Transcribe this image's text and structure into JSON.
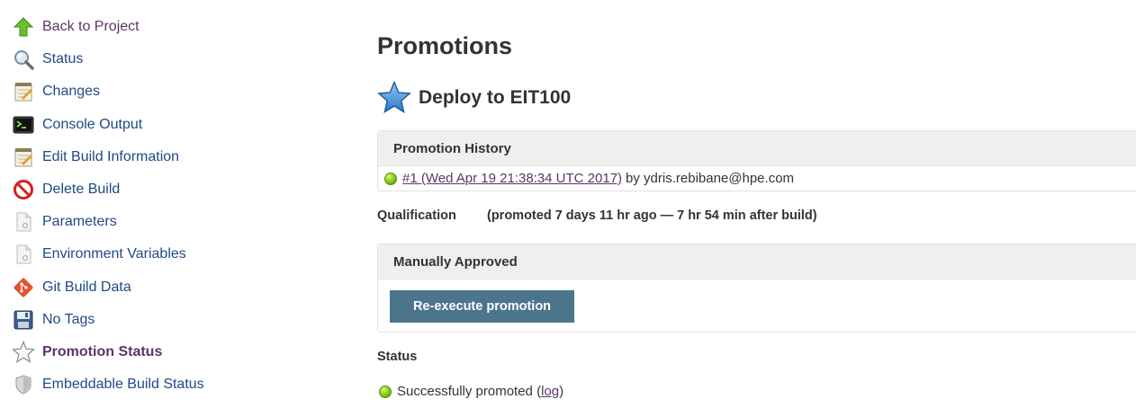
{
  "sidebar": {
    "items": [
      {
        "label": "Back to Project",
        "icon": "up-arrow-icon"
      },
      {
        "label": "Status",
        "icon": "magnifier-icon"
      },
      {
        "label": "Changes",
        "icon": "notepad-icon"
      },
      {
        "label": "Console Output",
        "icon": "terminal-icon"
      },
      {
        "label": "Edit Build Information",
        "icon": "notepad-edit-icon"
      },
      {
        "label": "Delete Build",
        "icon": "no-entry-icon"
      },
      {
        "label": "Parameters",
        "icon": "document-icon"
      },
      {
        "label": "Environment Variables",
        "icon": "document-icon"
      },
      {
        "label": "Git Build Data",
        "icon": "git-icon"
      },
      {
        "label": "No Tags",
        "icon": "floppy-disk-icon"
      },
      {
        "label": "Promotion Status",
        "icon": "star-outline-icon"
      },
      {
        "label": "Embeddable Build Status",
        "icon": "shield-icon"
      }
    ]
  },
  "main": {
    "title": "Promotions",
    "process": {
      "name": "Deploy to EIT100",
      "icon": "blue-star-icon"
    },
    "history": {
      "heading": "Promotion History",
      "entry_link": "#1 (Wed Apr 19 21:38:34 UTC 2017)",
      "entry_by": "by ydris.rebibane@hpe.com"
    },
    "qualification": {
      "label": "Qualification",
      "detail": "(promoted 7 days 11 hr ago — 7 hr 54 min after build)"
    },
    "approval": {
      "heading": "Manually Approved",
      "button_label": "Re-execute promotion"
    },
    "status": {
      "heading": "Status",
      "text_prefix": "Successfully promoted (",
      "link": "log",
      "text_suffix": ")"
    }
  },
  "colors": {
    "link_blue": "#204a87",
    "link_purple": "#5c3566",
    "button": "#4b758b",
    "panel_header": "#efefef",
    "success": "#8fcf1c"
  }
}
